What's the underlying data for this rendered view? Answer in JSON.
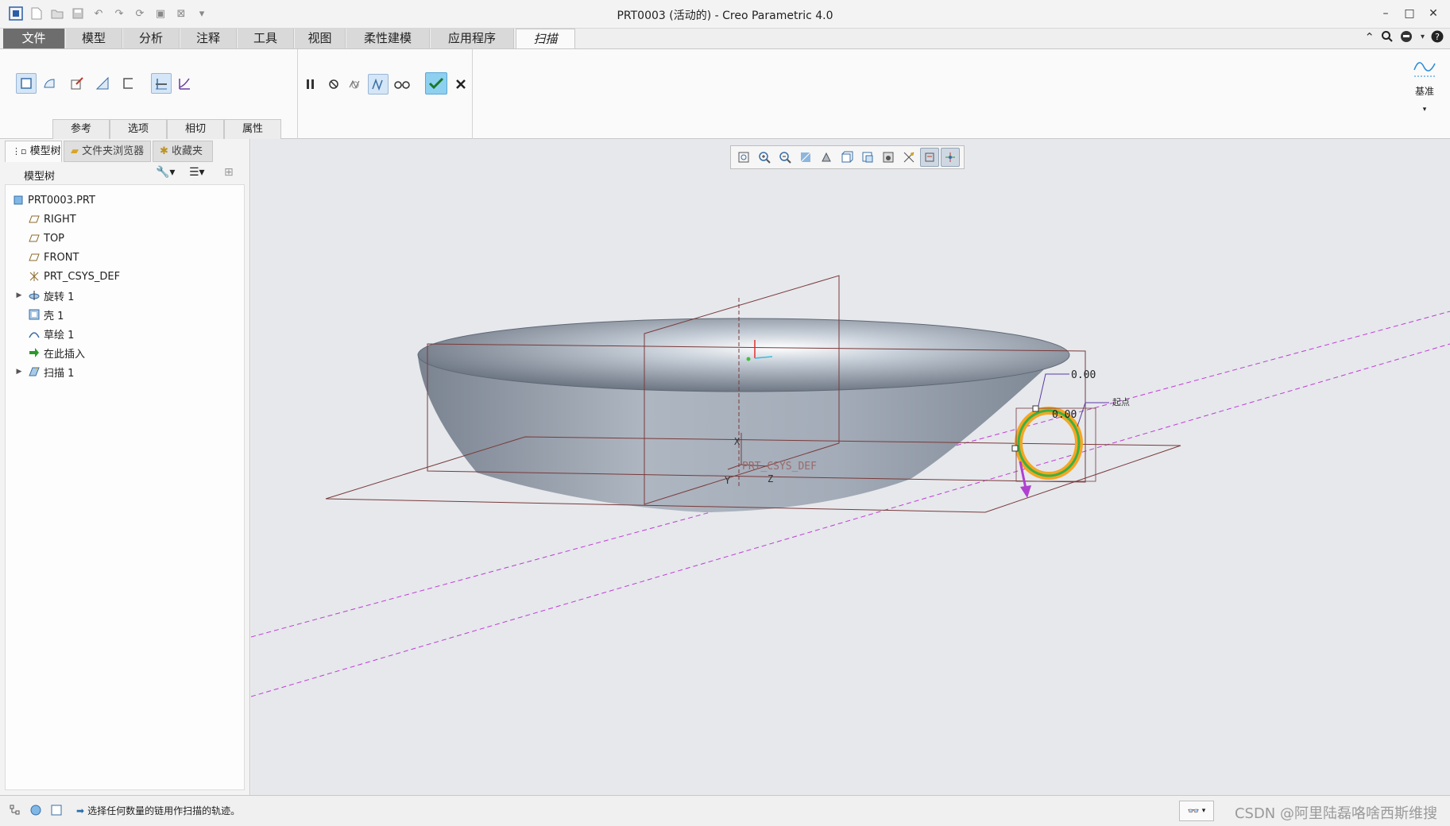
{
  "window": {
    "title": "PRT0003 (活动的) - Creo Parametric 4.0",
    "minimize": "–",
    "maximize": "□",
    "close": "✕"
  },
  "tabs": {
    "file": "文件",
    "model": "模型",
    "analysis": "分析",
    "annotate": "注释",
    "tools": "工具",
    "view": "视图",
    "flexible": "柔性建模",
    "applications": "应用程序",
    "sweep": "扫描"
  },
  "ribbon": {
    "subtabs": [
      "参考",
      "选项",
      "相切",
      "属性"
    ],
    "datum_label": "基准"
  },
  "left_panel": {
    "tabs": [
      "模型树",
      "文件夹浏览器",
      "收藏夹"
    ],
    "tree_header": "模型树",
    "items": [
      {
        "label": "PRT0003.PRT",
        "icon": "part-icon"
      },
      {
        "label": "RIGHT",
        "icon": "datum-plane-icon"
      },
      {
        "label": "TOP",
        "icon": "datum-plane-icon"
      },
      {
        "label": "FRONT",
        "icon": "datum-plane-icon"
      },
      {
        "label": "PRT_CSYS_DEF",
        "icon": "coordinate-system-icon"
      },
      {
        "label": "旋转 1",
        "icon": "revolve-icon"
      },
      {
        "label": "壳 1",
        "icon": "shell-icon"
      },
      {
        "label": "草绘 1",
        "icon": "sketch-icon"
      },
      {
        "label": "在此插入",
        "icon": "insert-arrow-icon"
      },
      {
        "label": "扫描 1",
        "icon": "sweep-icon"
      }
    ]
  },
  "viewport": {
    "dim_upper": "0.00",
    "dim_lower": "0.00",
    "start_label": "起点",
    "csys_label": "PRT_CSYS_DEF",
    "axis_x": "X",
    "axis_y": "Y",
    "axis_z": "Z"
  },
  "status": {
    "message": "选择任何数量的链用作扫描的轨迹。",
    "watermark": "CSDN @阿里陆磊咯啥西斯维搜"
  },
  "colors": {
    "file_tab": "#6d6d6d",
    "viewport_bg": "#e6e8ec",
    "accept_green": "#1a9e2a",
    "pressed_blue": "#d4e6f7",
    "trajectory_orange": "#f5a623",
    "trajectory_green": "#3cb043",
    "datum_magenta": "#c03cd6"
  }
}
